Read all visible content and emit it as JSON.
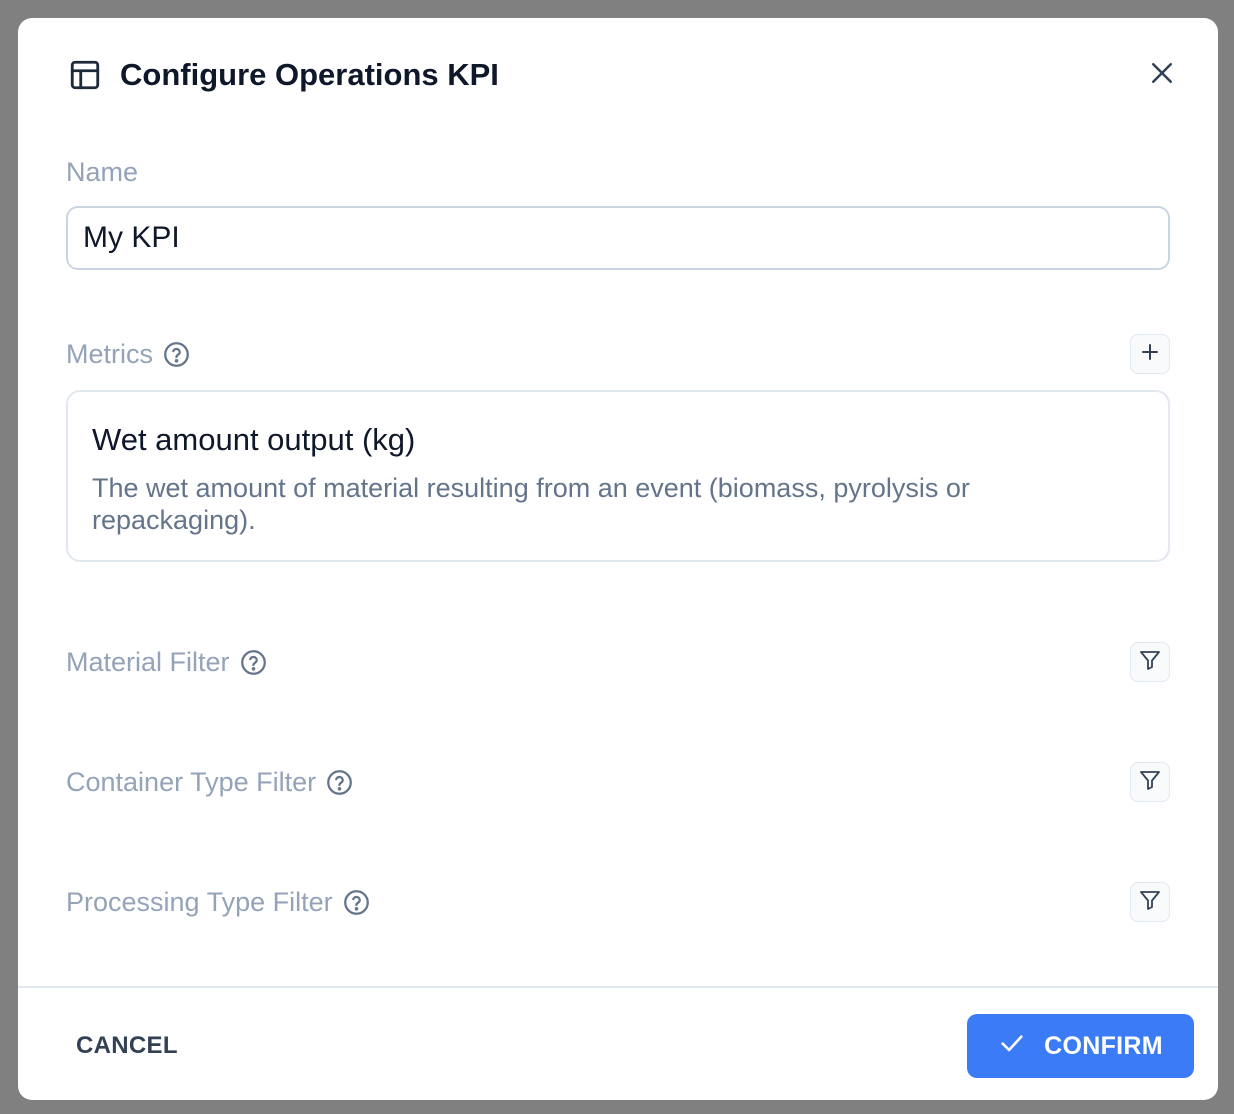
{
  "dialog": {
    "title": "Configure Operations KPI",
    "icon": "table-icon",
    "close_icon": "close-icon"
  },
  "name_field": {
    "label": "Name",
    "value": "My KPI"
  },
  "metrics": {
    "label": "Metrics",
    "help_icon": "help-circle-icon",
    "add_icon": "plus-icon",
    "items": [
      {
        "title": "Wet amount output (kg)",
        "description": "The wet amount of material resulting from an event (biomass, pyrolysis or repackaging)."
      }
    ]
  },
  "filters": [
    {
      "label": "Material Filter",
      "icon": "filter-icon"
    },
    {
      "label": "Container Type Filter",
      "icon": "filter-icon"
    },
    {
      "label": "Processing Type Filter",
      "icon": "filter-icon"
    }
  ],
  "footer": {
    "cancel_label": "CANCEL",
    "confirm_label": "CONFIRM",
    "confirm_icon": "check-icon"
  },
  "colors": {
    "primary": "#3b7cf6",
    "label": "#94a3b8",
    "overlay": "#808080"
  }
}
